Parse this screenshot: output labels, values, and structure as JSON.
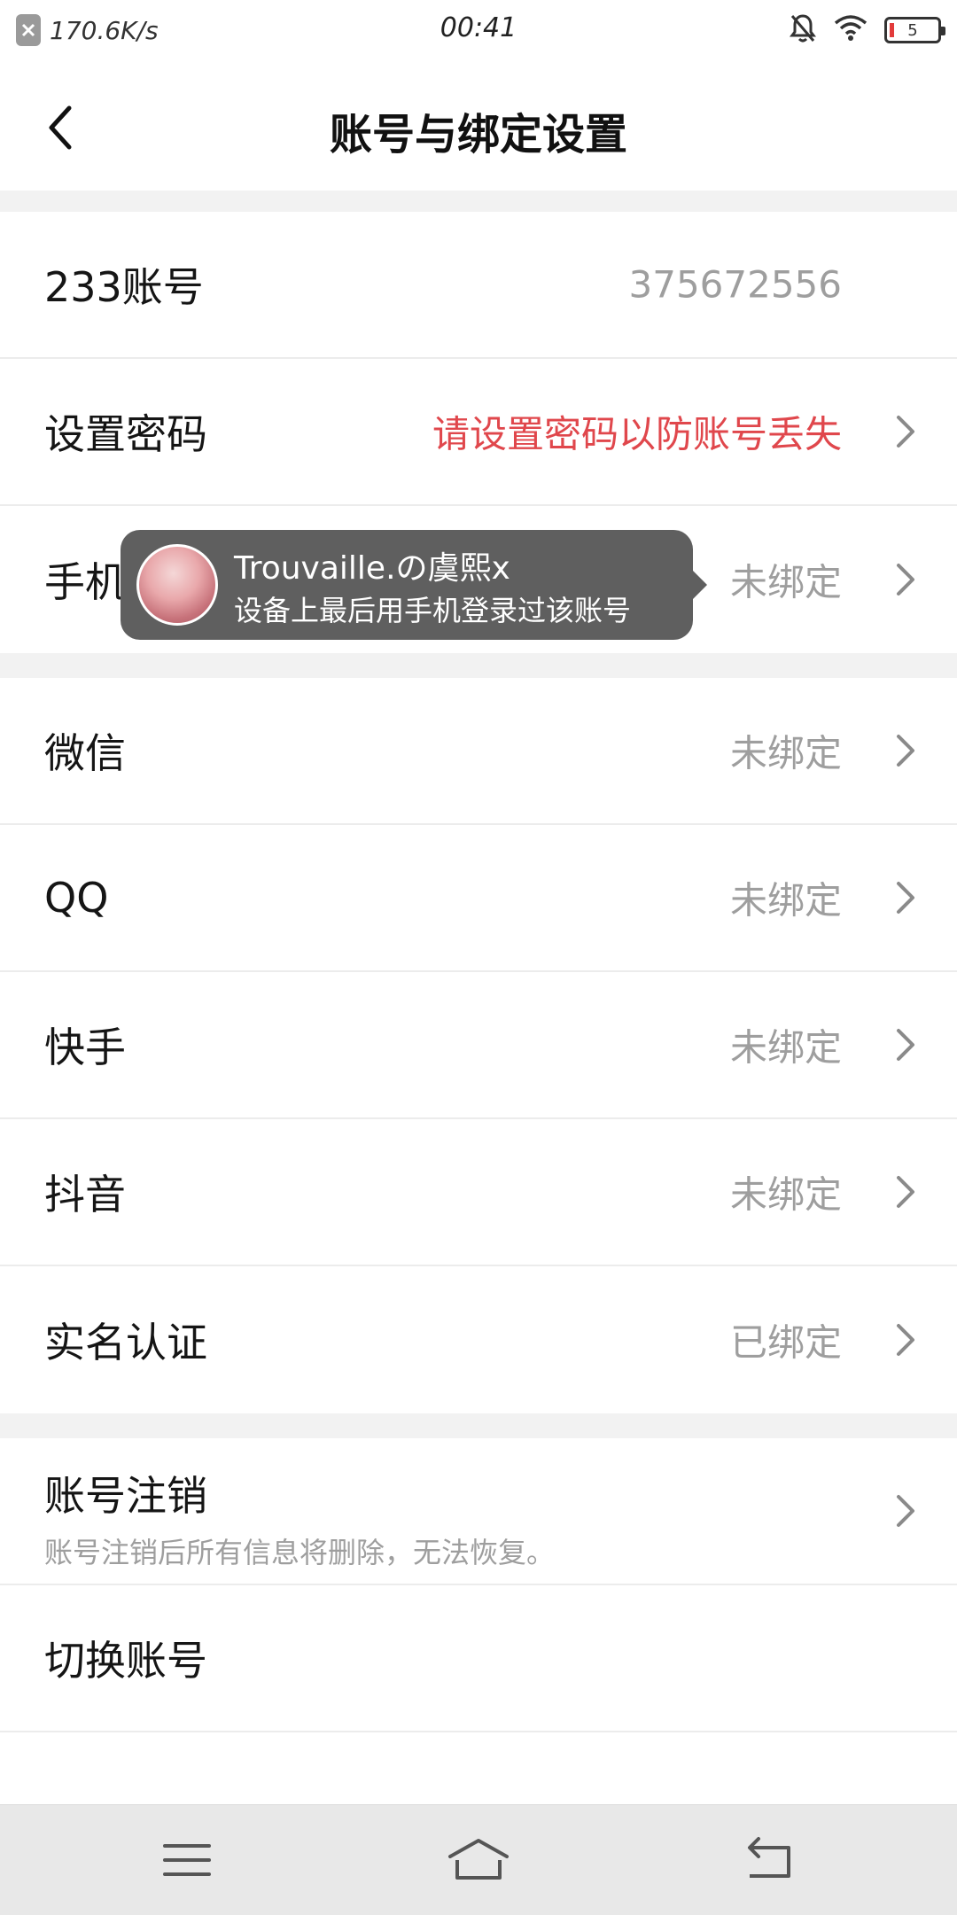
{
  "status_bar": {
    "speed": "170.6K/s",
    "time": "00:41",
    "battery_level": "5",
    "icons": [
      "close-icon",
      "mute-bell-icon",
      "wifi-icon",
      "battery-icon"
    ]
  },
  "header": {
    "title": "账号与绑定设置",
    "back_icon": "chevron-left-icon"
  },
  "rows": [
    {
      "label": "233账号",
      "value": "375672556"
    },
    {
      "label": "设置密码",
      "value": "请设置密码以防账号丢失"
    },
    {
      "label": "手机",
      "value": "未绑定"
    },
    {
      "label": "微信",
      "value": "未绑定"
    },
    {
      "label": "QQ",
      "value": "未绑定"
    },
    {
      "label": "快手",
      "value": "未绑定"
    },
    {
      "label": "抖音",
      "value": "未绑定"
    },
    {
      "label": "实名认证",
      "value": "已绑定"
    },
    {
      "label": "账号注销",
      "sub": "账号注销后所有信息将删除，无法恢复。"
    },
    {
      "label": "切换账号"
    }
  ],
  "tooltip": {
    "name": "Trouvaille.の虞熙x",
    "desc": "设备上最后用手机登录过该账号"
  },
  "colors": {
    "accent_red": "#e0474c",
    "muted_gray": "#9e9e9e",
    "group_gap": "#f2f2f2"
  },
  "nav": {
    "icons": [
      "menu-icon",
      "home-icon",
      "back-icon"
    ]
  }
}
